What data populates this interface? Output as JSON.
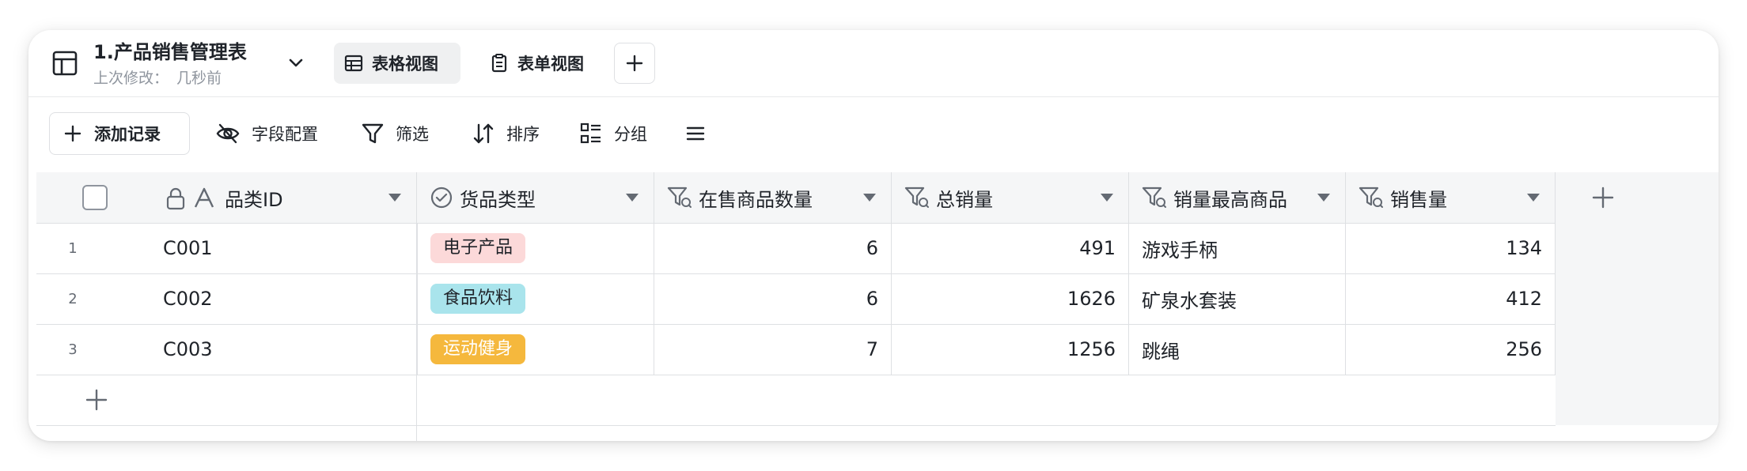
{
  "title": {
    "name": "1.产品销售管理表",
    "modified_label": "上次修改：",
    "modified_value": "几秒前"
  },
  "views": [
    {
      "label": "表格视图",
      "icon": "grid-table-icon",
      "active": true
    },
    {
      "label": "表单视图",
      "icon": "clipboard-form-icon",
      "active": false
    }
  ],
  "toolbar": {
    "add_record": "添加记录",
    "fields": "字段配置",
    "filter": "筛选",
    "sort": "排序",
    "group": "分组"
  },
  "columns": [
    {
      "label": "品类ID",
      "icon": "text-field-icon",
      "locked": true
    },
    {
      "label": "货品类型",
      "icon": "single-select-icon"
    },
    {
      "label": "在售商品数量",
      "icon": "lookup-field-icon"
    },
    {
      "label": "总销量",
      "icon": "lookup-field-icon"
    },
    {
      "label": "销量最高商品",
      "icon": "lookup-field-icon"
    },
    {
      "label": "销售量",
      "icon": "lookup-field-icon"
    }
  ],
  "rows": [
    {
      "index": "1",
      "id": "C001",
      "type": "电子产品",
      "type_color": "#fcd9d9",
      "type_text_color": "#1f2329",
      "count": "6",
      "total": "491",
      "top_item": "游戏手柄",
      "top_sales": "134"
    },
    {
      "index": "2",
      "id": "C002",
      "type": "食品饮料",
      "type_color": "#a9e4ec",
      "type_text_color": "#1f2329",
      "count": "6",
      "total": "1626",
      "top_item": "矿泉水套装",
      "top_sales": "412"
    },
    {
      "index": "3",
      "id": "C003",
      "type": "运动健身",
      "type_color": "#f5b83d",
      "type_text_color": "#ffffff",
      "count": "7",
      "total": "1256",
      "top_item": "跳绳",
      "top_sales": "256"
    }
  ]
}
